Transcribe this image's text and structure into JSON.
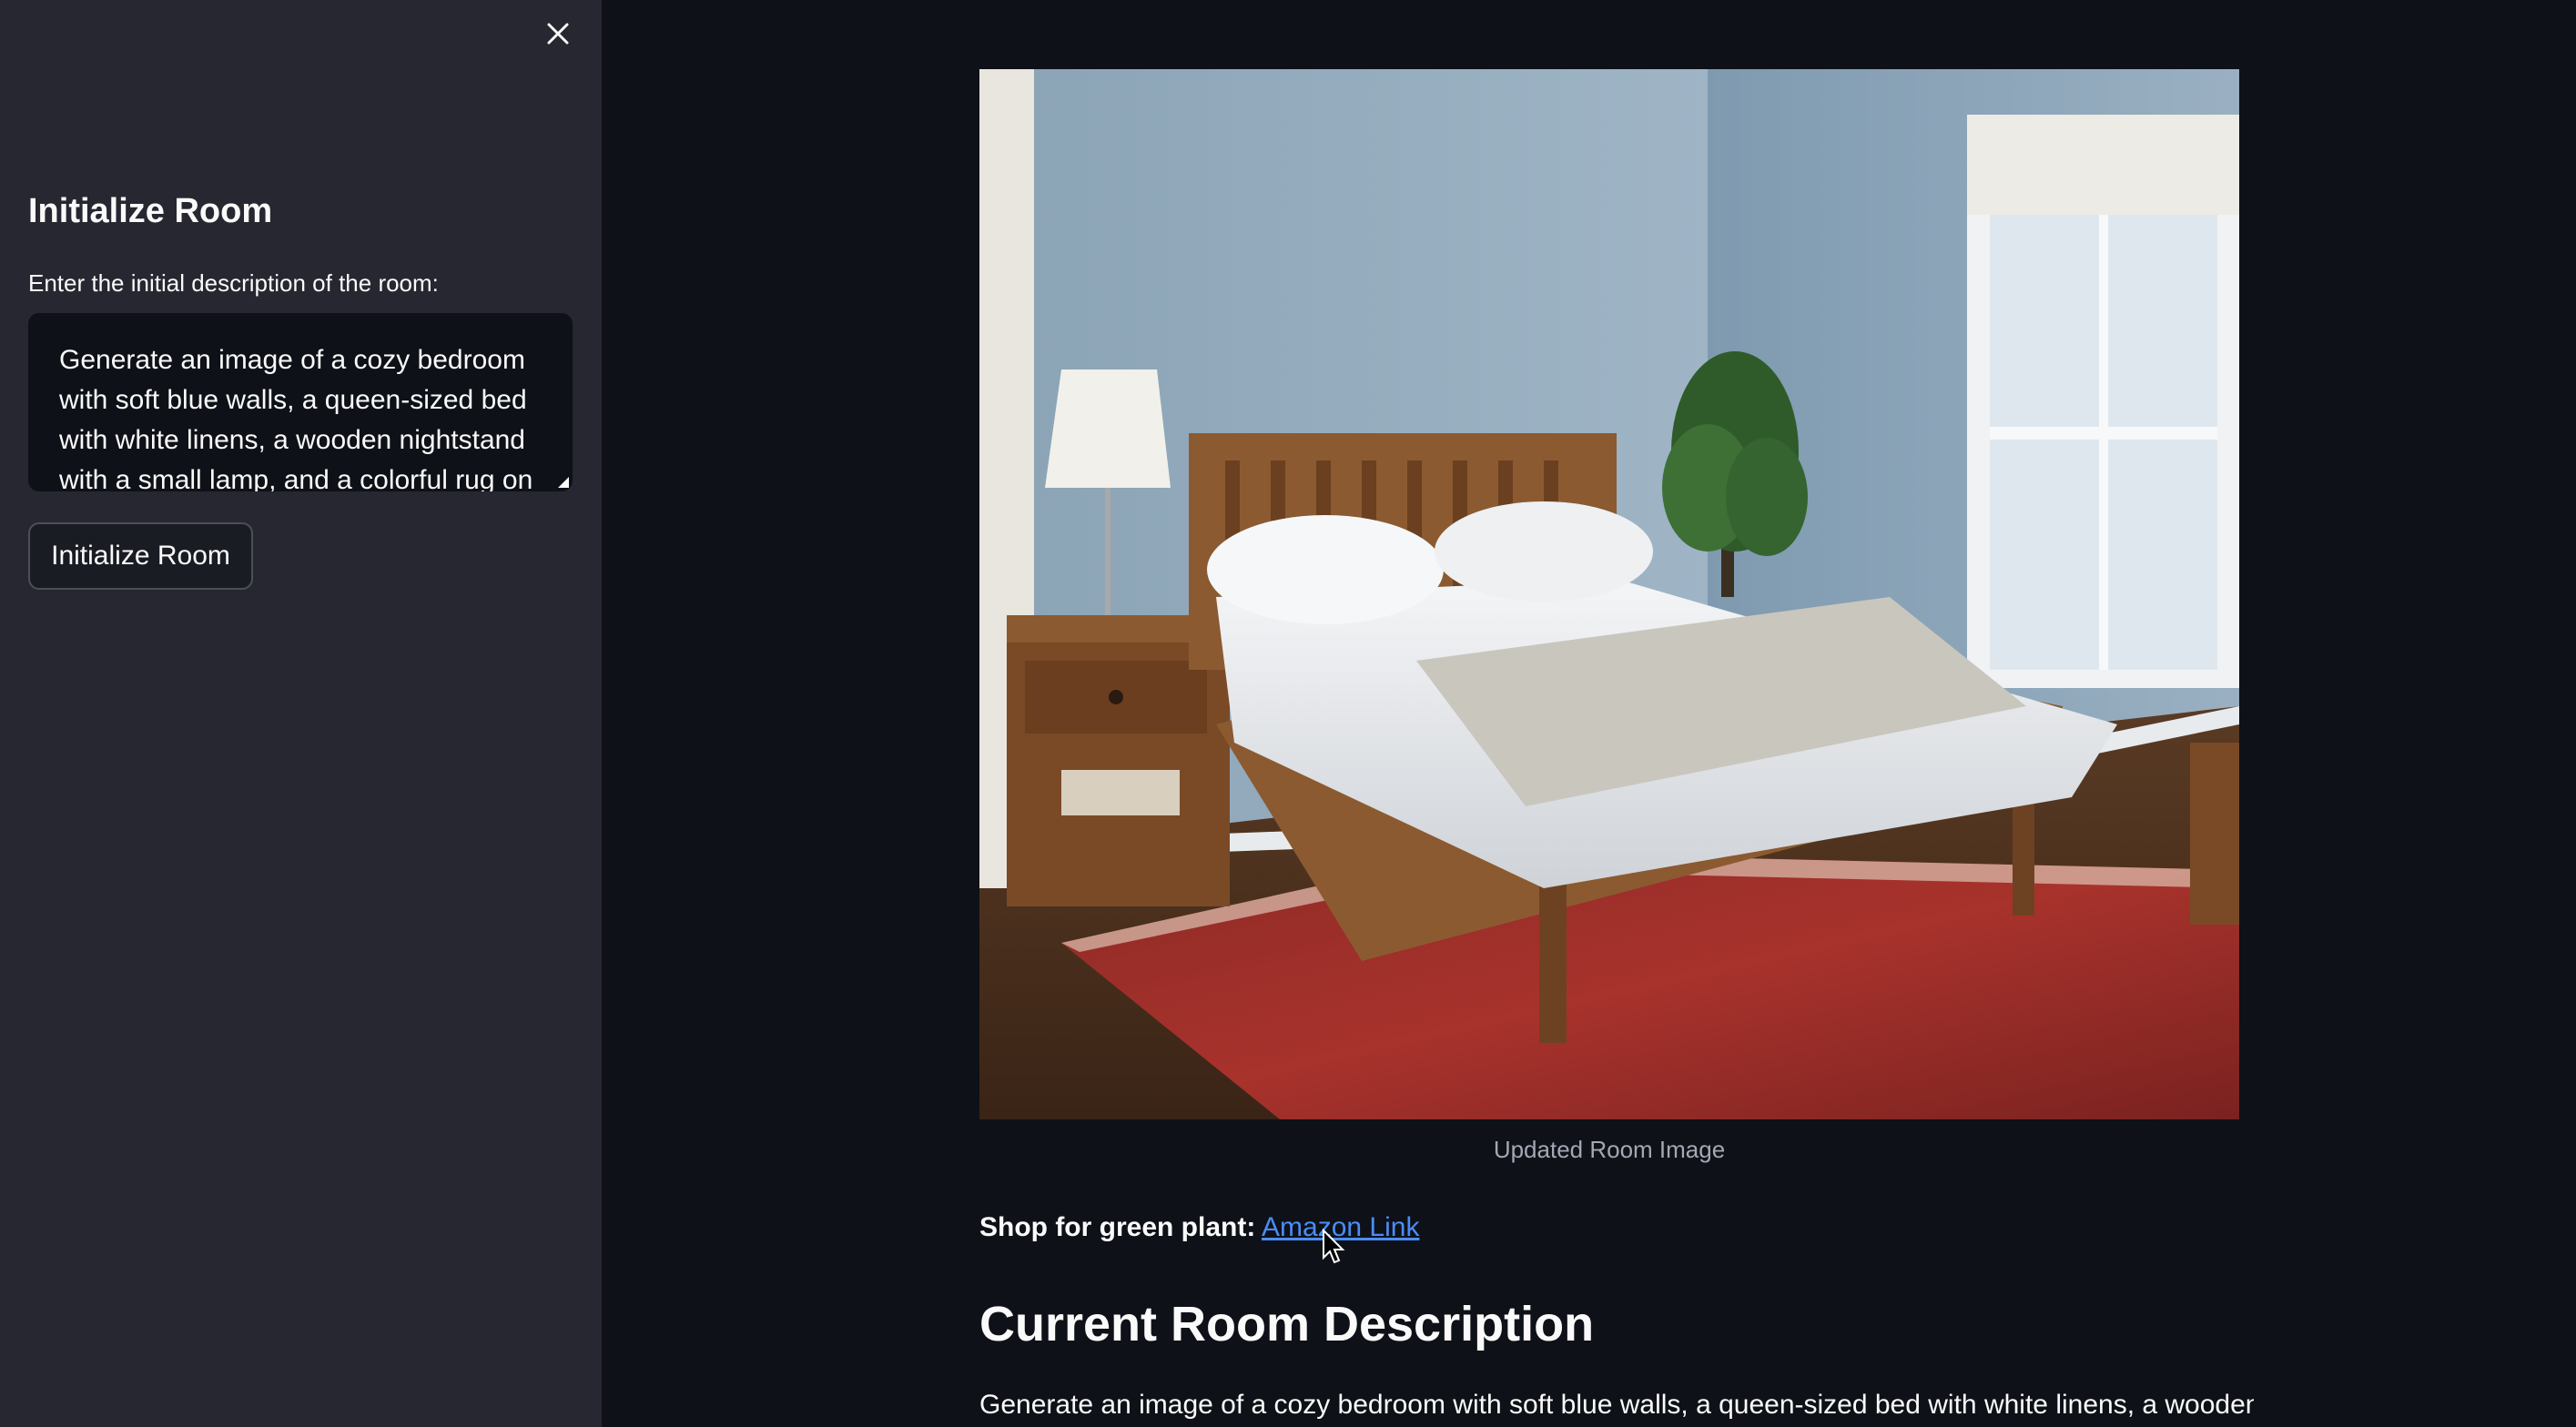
{
  "sidebar": {
    "title": "Initialize Room",
    "input_label": "Enter the initial description of the room:",
    "input_value": "Generate an image of a cozy bedroom with soft blue walls, a queen-sized bed with white linens, a wooden nightstand with a small lamp, and a colorful rug on",
    "button_label": "Initialize Room",
    "close_icon": "close-icon"
  },
  "main": {
    "image_caption": "Updated Room Image",
    "shop_label": "Shop for green plant:",
    "shop_link_text": "Amazon Link",
    "section_title": "Current Room Description",
    "description": "Generate an image of a cozy bedroom with soft blue walls, a queen-sized bed with white linens, a wooden"
  },
  "colors": {
    "sidebar_bg": "#262730",
    "main_bg": "#0e1117",
    "link": "#4a8df8",
    "caption": "#a3a8b4"
  }
}
